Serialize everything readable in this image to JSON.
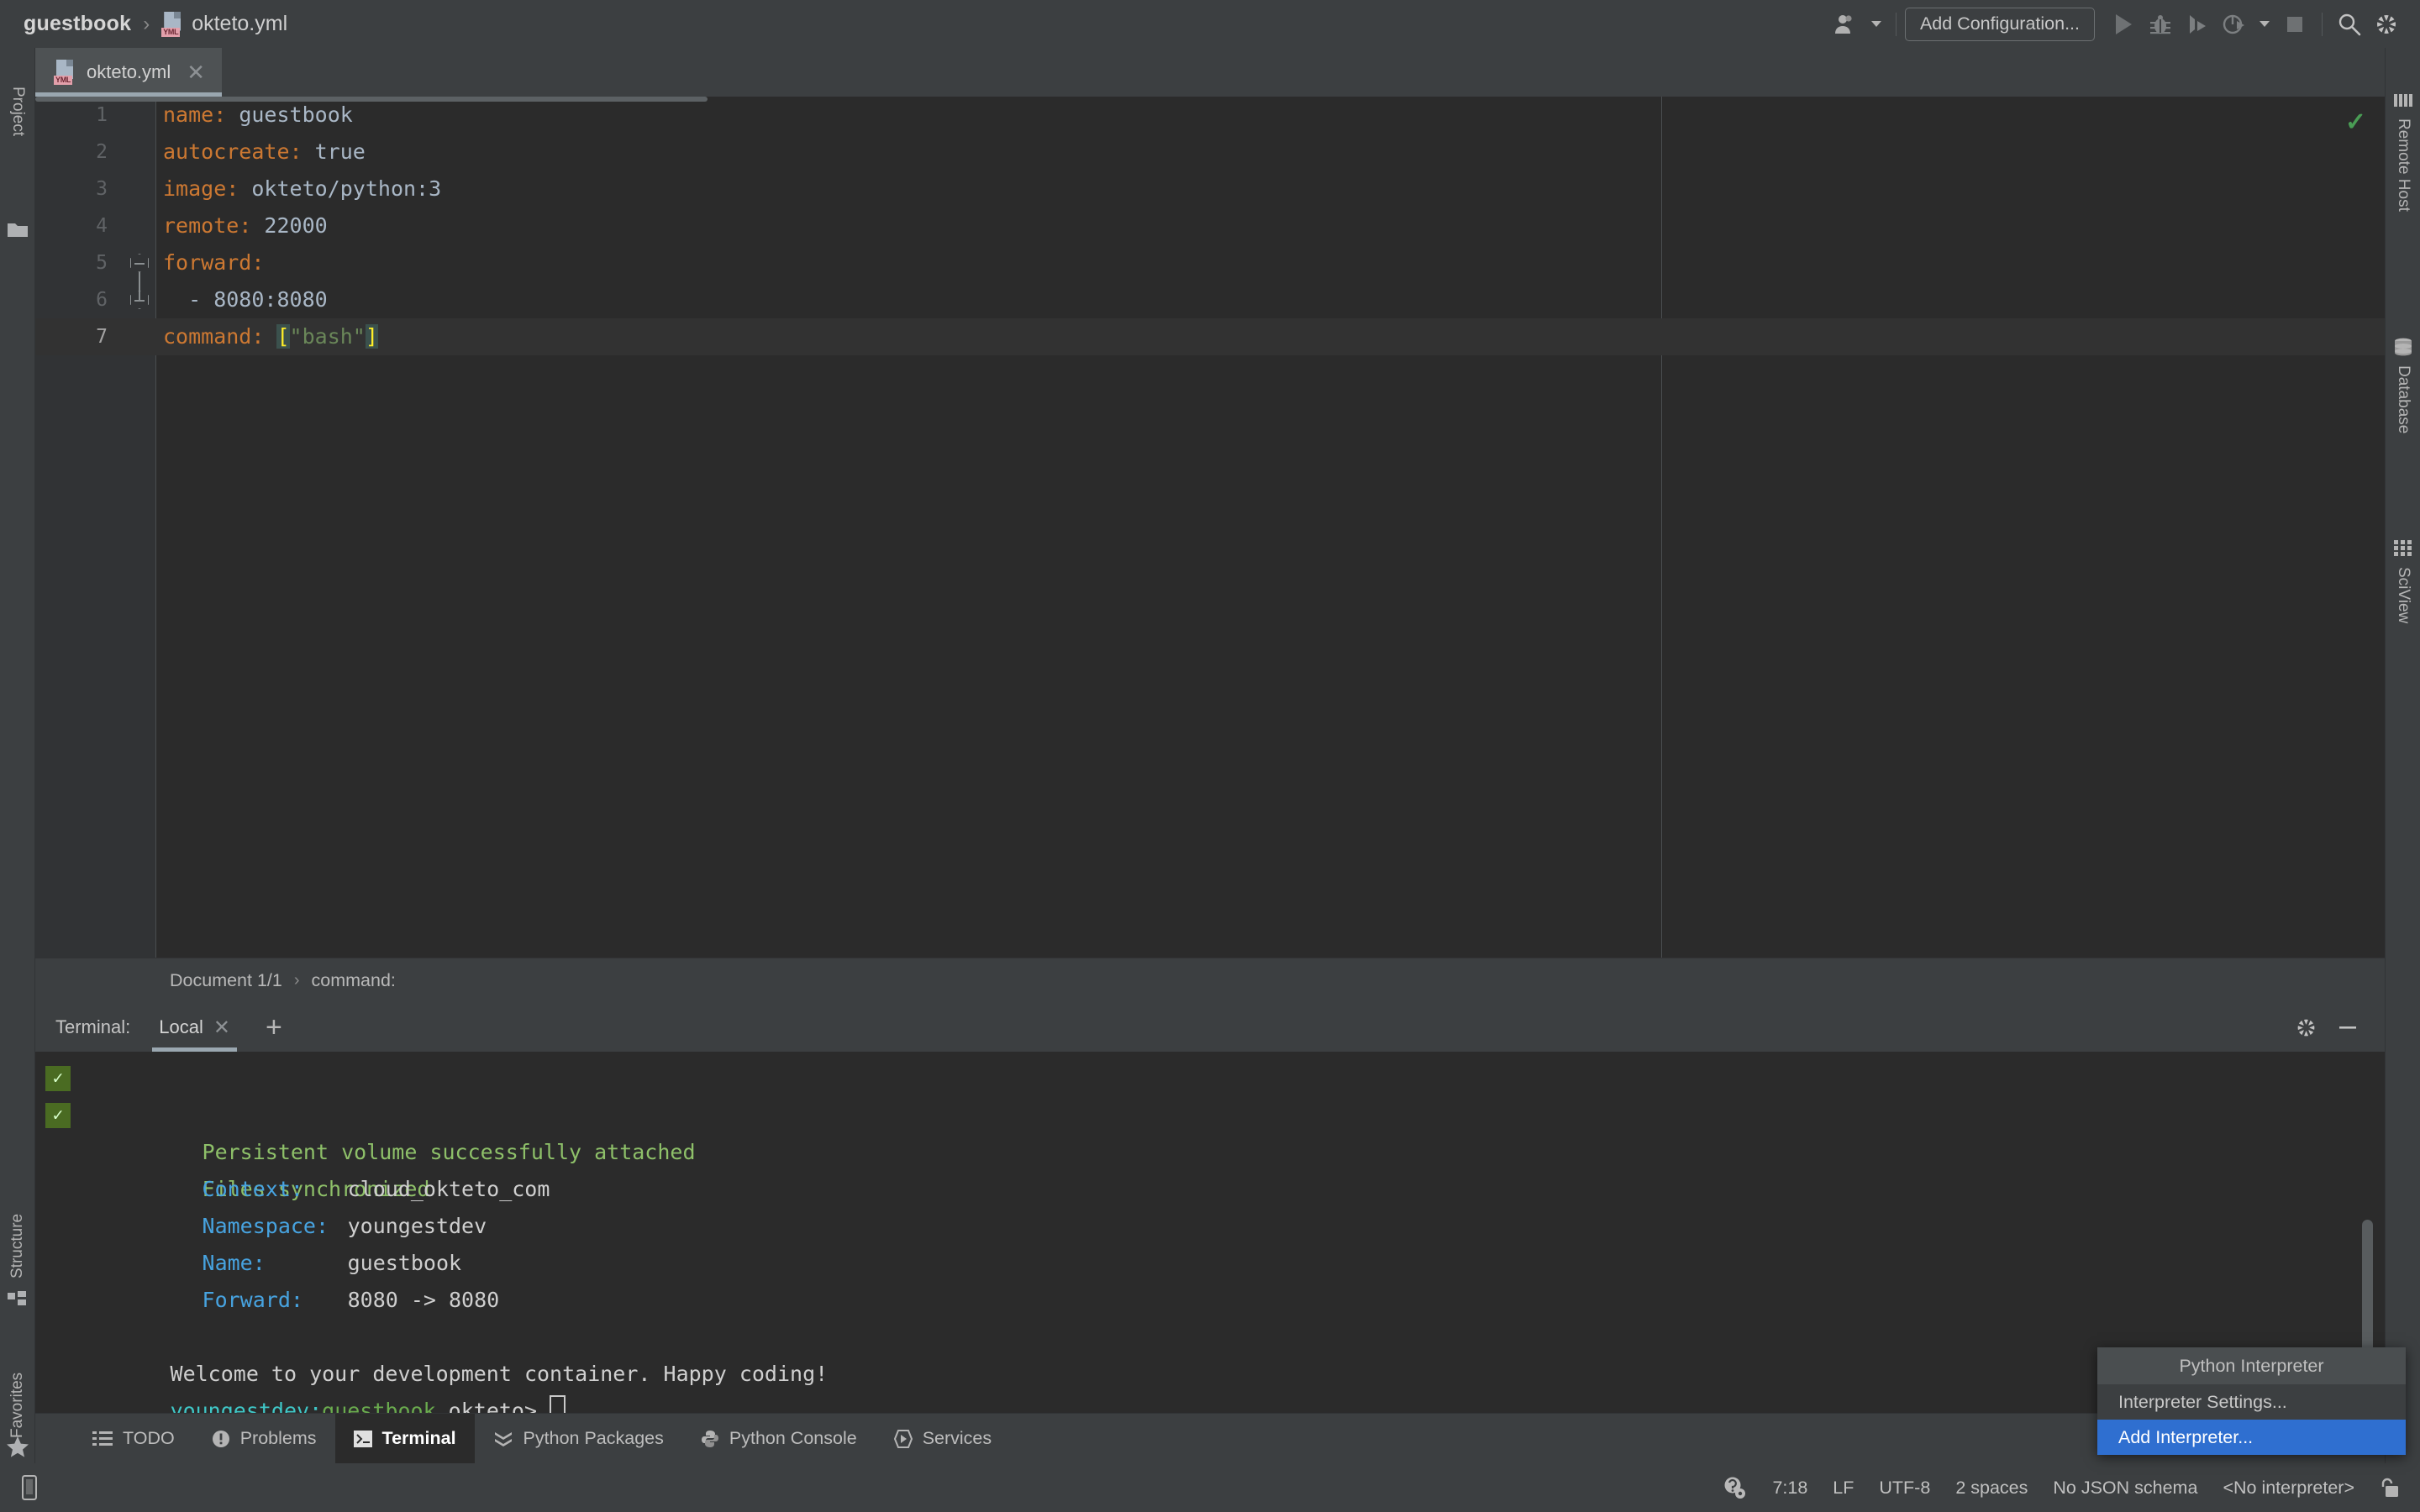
{
  "window": {
    "breadcrumb": {
      "project": "guestbook",
      "separator": "›",
      "file": "okteto.yml",
      "file_icon": "yml-file-icon",
      "badge": "YML"
    }
  },
  "toolbar": {
    "user_icon": "user-account-icon",
    "add_configuration_label": "Add Configuration...",
    "run_icon": "run-icon",
    "debug_icon": "debug-bug-icon",
    "run_with_coverage_icon": "run-with-coverage-icon",
    "profile_icon": "profile-icon",
    "dropdown_icon": "chevron-down-icon",
    "stop_icon": "stop-icon",
    "search_icon": "search-icon",
    "settings_icon": "gear-icon"
  },
  "left_strip": {
    "top": [
      {
        "label": "Project",
        "icon": "folder-icon"
      }
    ],
    "bottom": [
      {
        "label": "Structure",
        "icon": "structure-icon"
      },
      {
        "label": "Favorites",
        "icon": "star-icon"
      }
    ]
  },
  "right_strip": {
    "items": [
      {
        "label": "Remote Host",
        "icon": "remote-host-icon"
      },
      {
        "label": "Database",
        "icon": "database-icon"
      },
      {
        "label": "SciView",
        "icon": "sciview-grid-icon"
      }
    ]
  },
  "editor": {
    "tabs": [
      {
        "label": "okteto.yml",
        "icon": "yml-file-icon",
        "badge": "YML",
        "close_icon": "close-icon",
        "active": true
      }
    ],
    "inspection_status_icon": "green-check-icon",
    "lines": [
      {
        "num": "1",
        "key": "name",
        "colon": ":",
        "value": " guestbook",
        "fold": null
      },
      {
        "num": "2",
        "key": "autocreate",
        "colon": ":",
        "value": " true",
        "fold": null
      },
      {
        "num": "3",
        "key": "image",
        "colon": ":",
        "value": " okteto/python:3",
        "fold": null
      },
      {
        "num": "4",
        "key": "remote",
        "colon": ":",
        "value": " 22000",
        "fold": null
      },
      {
        "num": "5",
        "key": "forward",
        "colon": ":",
        "value": "",
        "fold": "collapse"
      },
      {
        "num": "6",
        "key": "",
        "colon": "",
        "value": "  - 8080:8080",
        "fold": "collapse-end"
      },
      {
        "num": "7",
        "key": "command",
        "colon": ":",
        "value": " [\"bash\"]",
        "fold": null,
        "current": true
      }
    ],
    "raw_text": "name: guestbook\nautocreate: true\nimage: okteto/python:3\nremote: 22000\nforward:\n  - 8080:8080\ncommand: [\"bash\"]",
    "breadcrumb": {
      "document": "Document 1/1",
      "separator": "›",
      "node": "command:"
    }
  },
  "terminal": {
    "title": "Terminal:",
    "tab": {
      "label": "Local",
      "close_icon": "close-icon"
    },
    "add_icon": "plus-icon",
    "settings_icon": "gear-icon",
    "minimize_icon": "minimize-icon",
    "lines": [
      {
        "badge": "✓",
        "text": "Persistent volume successfully attached",
        "style": "green"
      },
      {
        "badge": "✓",
        "text": "Files synchronized",
        "style": "green"
      },
      {
        "badge": null,
        "label": "Context:",
        "value": "cloud_okteto_com",
        "style": "kv"
      },
      {
        "badge": null,
        "label": "Namespace:",
        "value": "youngestdev",
        "style": "kv"
      },
      {
        "badge": null,
        "label": "Name:",
        "value": "guestbook",
        "style": "kv"
      },
      {
        "badge": null,
        "label": "Forward:",
        "value": "8080 -> 8080",
        "style": "kv"
      },
      {
        "badge": null,
        "text": "",
        "style": "blank"
      },
      {
        "badge": null,
        "text": "Welcome to your development container. Happy coding!",
        "style": "white"
      }
    ],
    "prompt": {
      "user": "youngestdev",
      "colon": ":",
      "path": "guestbook",
      "symbol": " okteto>",
      "cursor": true
    }
  },
  "bottom_tabs": [
    {
      "label": "TODO",
      "icon": "todo-list-icon",
      "active": false
    },
    {
      "label": "Problems",
      "icon": "problems-icon",
      "active": false
    },
    {
      "label": "Terminal",
      "icon": "terminal-icon",
      "active": true
    },
    {
      "label": "Python Packages",
      "icon": "python-packages-icon",
      "active": false
    },
    {
      "label": "Python Console",
      "icon": "python-console-icon",
      "active": false
    },
    {
      "label": "Services",
      "icon": "services-icon",
      "active": false
    }
  ],
  "status_bar": {
    "left_icon": "device-icon",
    "items": [
      {
        "name": "event-log-icon",
        "label": "",
        "icon": "event-log-icon"
      },
      {
        "name": "caret-position",
        "label": "7:18"
      },
      {
        "name": "line-separator",
        "label": "LF"
      },
      {
        "name": "file-encoding",
        "label": "UTF-8"
      },
      {
        "name": "indent",
        "label": "2 spaces"
      },
      {
        "name": "json-schema",
        "label": "No JSON schema"
      },
      {
        "name": "interpreter",
        "label": "<No interpreter>"
      },
      {
        "name": "lock-icon",
        "label": "",
        "icon": "unlocked-padlock-icon"
      }
    ]
  },
  "popup": {
    "header": "Python Interpreter",
    "items": [
      {
        "label": "Interpreter Settings...",
        "selected": false
      },
      {
        "label": "Add Interpreter...",
        "selected": true
      }
    ]
  },
  "colors": {
    "bg_chrome": "#3c3f41",
    "bg_editor": "#2b2b2b",
    "gutter": "#313335",
    "accent_blue": "#2f6fd0",
    "yaml_key": "#cc7832",
    "yaml_string": "#6a8759",
    "bracket_hl_bg": "#3b514d",
    "bracket_hl_fg": "#ffef28",
    "terminal_green": "#8ec069",
    "terminal_blue": "#47a3e0",
    "ok_badge_bg": "#4a6b22",
    "tab_underline": "#9aa7b0",
    "check_green": "#499c54"
  }
}
